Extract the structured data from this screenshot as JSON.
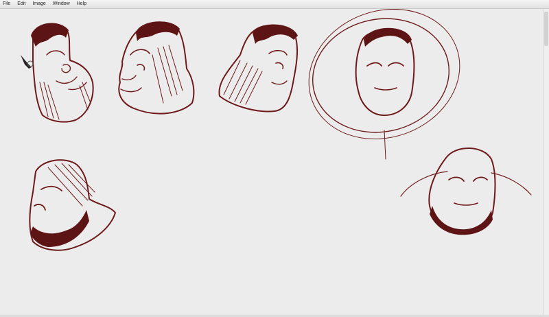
{
  "menu": {
    "items": [
      "File",
      "Edit",
      "Image",
      "Window",
      "Help"
    ]
  },
  "colors": {
    "ink": "#6e1a1a",
    "canvas": "#ececec",
    "menubar": "#ededed"
  },
  "icons": {
    "pen_cursor": "pen-cursor-icon"
  }
}
